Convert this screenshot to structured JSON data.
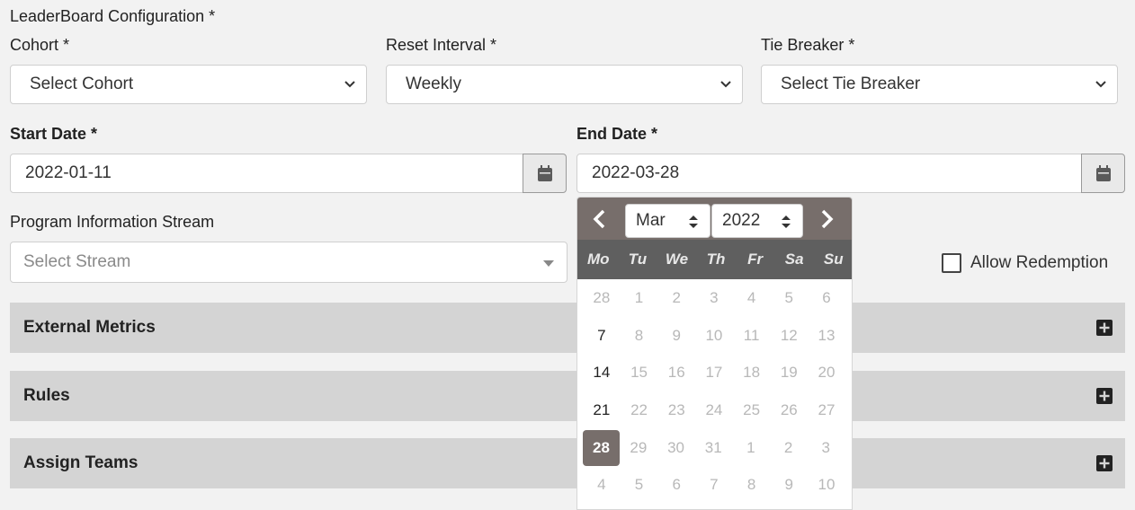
{
  "form": {
    "title": "LeaderBoard Configuration *",
    "cohort": {
      "label": "Cohort *",
      "value": "Select Cohort"
    },
    "reset_interval": {
      "label": "Reset Interval *",
      "value": "Weekly"
    },
    "tie_breaker": {
      "label": "Tie Breaker *",
      "value": "Select Tie Breaker"
    },
    "start_date": {
      "label": "Start Date *",
      "value": "2022-01-11"
    },
    "end_date": {
      "label": "End Date *",
      "value": "2022-03-28"
    },
    "stream": {
      "label": "Program Information Stream",
      "placeholder": "Select Stream"
    },
    "allow_redemption": {
      "label": "Allow Redemption",
      "checked": false
    }
  },
  "panels": [
    {
      "title": "External Metrics"
    },
    {
      "title": "Rules"
    },
    {
      "title": "Assign Teams"
    }
  ],
  "datepicker": {
    "month": "Mar",
    "year": "2022",
    "weekdays": [
      "Mo",
      "Tu",
      "We",
      "Th",
      "Fr",
      "Sa",
      "Su"
    ],
    "weeks": [
      [
        {
          "d": "28",
          "s": "muted"
        },
        {
          "d": "1",
          "s": "muted"
        },
        {
          "d": "2",
          "s": "muted"
        },
        {
          "d": "3",
          "s": "muted"
        },
        {
          "d": "4",
          "s": "muted"
        },
        {
          "d": "5",
          "s": "muted"
        },
        {
          "d": "6",
          "s": "muted"
        }
      ],
      [
        {
          "d": "7",
          "s": "avail"
        },
        {
          "d": "8",
          "s": "muted"
        },
        {
          "d": "9",
          "s": "muted"
        },
        {
          "d": "10",
          "s": "muted"
        },
        {
          "d": "11",
          "s": "muted"
        },
        {
          "d": "12",
          "s": "muted"
        },
        {
          "d": "13",
          "s": "muted"
        }
      ],
      [
        {
          "d": "14",
          "s": "avail"
        },
        {
          "d": "15",
          "s": "muted"
        },
        {
          "d": "16",
          "s": "muted"
        },
        {
          "d": "17",
          "s": "muted"
        },
        {
          "d": "18",
          "s": "muted"
        },
        {
          "d": "19",
          "s": "muted"
        },
        {
          "d": "20",
          "s": "muted"
        }
      ],
      [
        {
          "d": "21",
          "s": "avail"
        },
        {
          "d": "22",
          "s": "muted"
        },
        {
          "d": "23",
          "s": "muted"
        },
        {
          "d": "24",
          "s": "muted"
        },
        {
          "d": "25",
          "s": "muted"
        },
        {
          "d": "26",
          "s": "muted"
        },
        {
          "d": "27",
          "s": "muted"
        }
      ],
      [
        {
          "d": "28",
          "s": "sel"
        },
        {
          "d": "29",
          "s": "muted"
        },
        {
          "d": "30",
          "s": "muted"
        },
        {
          "d": "31",
          "s": "muted"
        },
        {
          "d": "1",
          "s": "muted"
        },
        {
          "d": "2",
          "s": "muted"
        },
        {
          "d": "3",
          "s": "muted"
        }
      ],
      [
        {
          "d": "4",
          "s": "muted"
        },
        {
          "d": "5",
          "s": "muted"
        },
        {
          "d": "6",
          "s": "muted"
        },
        {
          "d": "7",
          "s": "muted"
        },
        {
          "d": "8",
          "s": "muted"
        },
        {
          "d": "9",
          "s": "muted"
        },
        {
          "d": "10",
          "s": "muted"
        }
      ]
    ]
  },
  "icons": {
    "calendar": "calendar-icon",
    "chevron": "chevron-down-icon",
    "plus": "plus-square-icon",
    "prev": "chevron-left-icon",
    "next": "chevron-right-icon"
  },
  "colors": {
    "datepicker_header": "#776e6b",
    "weekday_bar": "#5f5f5f",
    "panel_bg": "#d4d4d4",
    "page_bg": "#f2f2f2"
  }
}
